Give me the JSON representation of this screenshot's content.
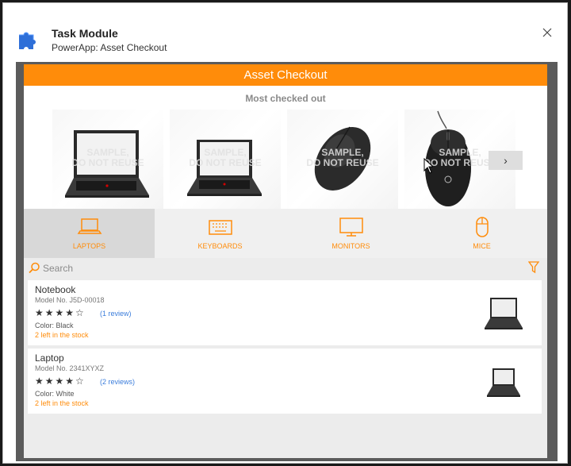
{
  "dialog": {
    "title": "Task Module",
    "subtitle": "PowerApp: Asset Checkout"
  },
  "app": {
    "title": "Asset Checkout",
    "carousel_title": "Most checked out",
    "watermark_line1": "SAMPLE,",
    "watermark_line2": "DO NOT REUSE",
    "carousel_items": [
      "laptop",
      "laptop",
      "mouse",
      "mouse"
    ],
    "next_glyph": "›"
  },
  "tabs": [
    {
      "label": "LAPTOPS",
      "icon": "laptop-icon",
      "active": true
    },
    {
      "label": "KEYBOARDS",
      "icon": "keyboard-icon",
      "active": false
    },
    {
      "label": "MONITORS",
      "icon": "monitor-icon",
      "active": false
    },
    {
      "label": "MICE",
      "icon": "mouse-icon",
      "active": false
    }
  ],
  "search": {
    "placeholder": "Search"
  },
  "items": [
    {
      "name": "Notebook",
      "model": "Model No. J5D-00018",
      "stars": "★★★★☆",
      "reviews": "(1 review)",
      "color": "Color: Black",
      "stock": "2 left in the stock"
    },
    {
      "name": "Laptop",
      "model": "Model No. 2341XYXZ",
      "stars": "★★★★☆",
      "reviews": "(2 reviews)",
      "color": "Color: White",
      "stock": "2 left in the stock"
    }
  ],
  "colors": {
    "accent": "#ff8c0a",
    "link": "#3b7ddb",
    "tab_active_bg": "#d8d8d8",
    "frame": "#5b5b5b"
  }
}
